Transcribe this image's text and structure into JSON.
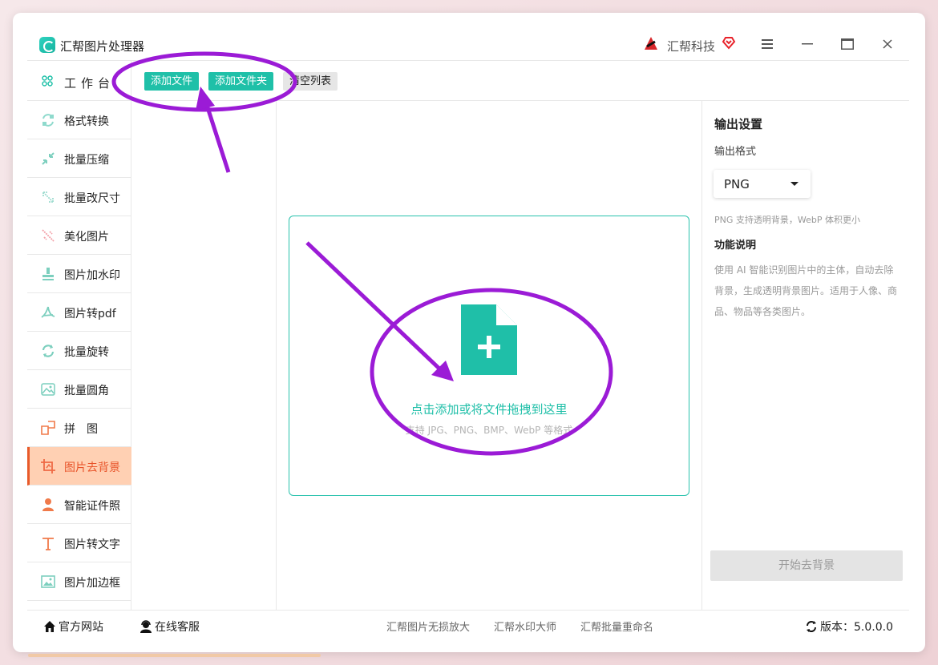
{
  "titlebar": {
    "app_title": "汇帮图片处理器",
    "brand_name": "汇帮科技",
    "menu_icon": "menu-icon",
    "minimize_icon": "minimize-icon",
    "maximize_icon": "maximize-icon",
    "close_icon": "close-icon"
  },
  "sidebar": {
    "workbench_label": "工作台",
    "items": [
      {
        "label": "格式转换",
        "icon": "format-convert-icon"
      },
      {
        "label": "批量压缩",
        "icon": "compress-icon"
      },
      {
        "label": "批量改尺寸",
        "icon": "resize-icon"
      },
      {
        "label": "美化图片",
        "icon": "beautify-icon"
      },
      {
        "label": "图片加水印",
        "icon": "watermark-icon"
      },
      {
        "label": "图片转pdf",
        "icon": "pdf-icon"
      },
      {
        "label": "批量旋转",
        "icon": "rotate-icon"
      },
      {
        "label": "批量圆角",
        "icon": "round-corner-icon"
      },
      {
        "label": "拼　图",
        "icon": "collage-icon"
      },
      {
        "label": "图片去背景",
        "icon": "crop-icon",
        "active": true
      },
      {
        "label": "智能证件照",
        "icon": "id-photo-icon"
      },
      {
        "label": "图片转文字",
        "icon": "text-icon"
      },
      {
        "label": "图片加边框",
        "icon": "frame-icon"
      }
    ]
  },
  "toolbar": {
    "add_file": "添加文件",
    "add_folder": "添加文件夹",
    "clear_list": "清空列表"
  },
  "dropzone": {
    "title": "点击添加或将文件拖拽到这里",
    "subtitle": "支持 JPG、PNG、BMP、WebP 等格式"
  },
  "right_panel": {
    "title": "输出设置",
    "format_label": "输出格式",
    "format_value": "PNG",
    "hint": "PNG 支持透明背景，WebP 体积更小",
    "section_title": "功能说明",
    "description": "使用 AI 智能识别图片中的主体，自动去除背景，生成透明背景图片。适用于人像、商品、物品等各类图片。",
    "start_button": "开始去背景"
  },
  "footer": {
    "website": "官方网站",
    "support": "在线客服",
    "links": [
      "汇帮图片无损放大",
      "汇帮水印大师",
      "汇帮批量重命名"
    ],
    "version": "版本：5.0.0.0"
  },
  "colors": {
    "accent": "#1fc0a8",
    "active_bg": "#ffd0b3",
    "active_text": "#e8542a",
    "annotation": "#9b1bd6"
  }
}
